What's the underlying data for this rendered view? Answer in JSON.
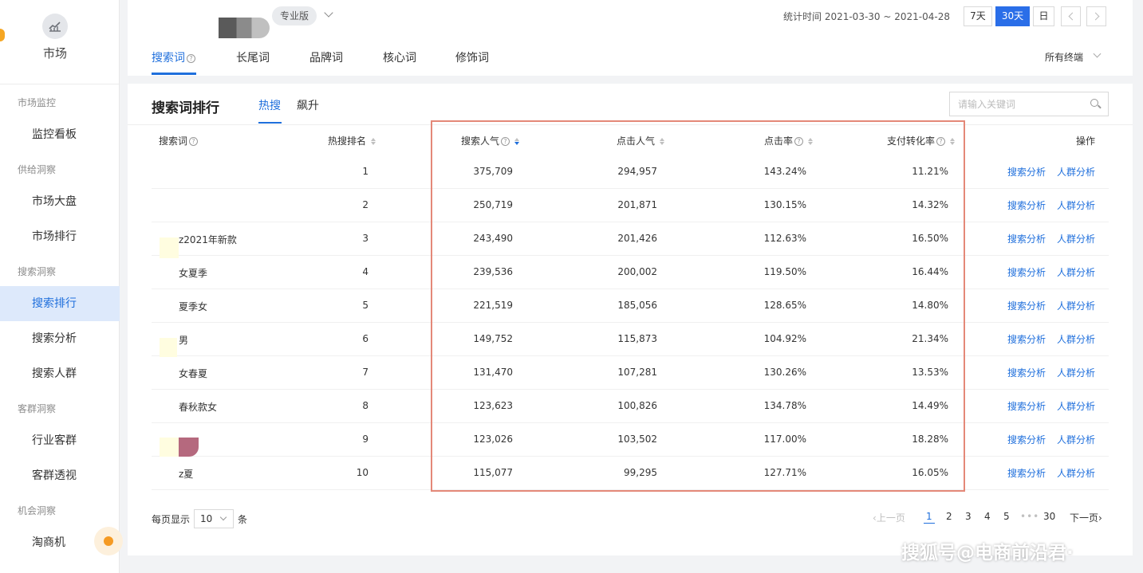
{
  "sidebar": {
    "title": "市场",
    "groups": [
      {
        "label": "市场监控",
        "items": [
          "监控看板"
        ]
      },
      {
        "label": "供给洞察",
        "items": [
          "市场大盘",
          "市场排行"
        ]
      },
      {
        "label": "搜索洞察",
        "items": [
          "搜索排行",
          "搜索分析",
          "搜索人群"
        ]
      },
      {
        "label": "客群洞察",
        "items": [
          "行业客群",
          "客群透视"
        ]
      },
      {
        "label": "机会洞察",
        "items": [
          "淘商机"
        ]
      }
    ],
    "active_item": "搜索排行"
  },
  "header": {
    "edition": "专业版",
    "stat_time": "统计时间 2021-03-30 ~ 2021-04-28",
    "periods": [
      "7天",
      "30天",
      "日"
    ],
    "active_period": "30天",
    "tabs": [
      "搜索词",
      "长尾词",
      "品牌词",
      "核心词",
      "修饰词"
    ],
    "active_tab": "搜索词",
    "terminal": "所有终端"
  },
  "ranking": {
    "title": "搜索词排行",
    "subtabs": [
      "热搜",
      "飙升"
    ],
    "active_subtab": "热搜",
    "search_placeholder": "请输入关键词",
    "columns": [
      "搜索词",
      "热搜排名",
      "搜索人气",
      "点击人气",
      "点击率",
      "支付转化率",
      "操作"
    ],
    "sorted_column": "搜索人气",
    "sort_order": "desc",
    "rows": [
      {
        "term": "",
        "rank": "1",
        "search": "375,709",
        "click": "294,957",
        "ctr": "143.24%",
        "cvr": "11.21%"
      },
      {
        "term": "",
        "rank": "2",
        "search": "250,719",
        "click": "201,871",
        "ctr": "130.15%",
        "cvr": "14.32%"
      },
      {
        "term": "z2021年新款",
        "rank": "3",
        "search": "243,490",
        "click": "201,426",
        "ctr": "112.63%",
        "cvr": "16.50%"
      },
      {
        "term": "女夏季",
        "rank": "4",
        "search": "239,536",
        "click": "200,002",
        "ctr": "119.50%",
        "cvr": "16.44%"
      },
      {
        "term": "夏季女",
        "rank": "5",
        "search": "221,519",
        "click": "185,056",
        "ctr": "128.65%",
        "cvr": "14.80%"
      },
      {
        "term": "男",
        "rank": "6",
        "search": "149,752",
        "click": "115,873",
        "ctr": "104.92%",
        "cvr": "21.34%"
      },
      {
        "term": "女春夏",
        "rank": "7",
        "search": "131,470",
        "click": "107,281",
        "ctr": "130.26%",
        "cvr": "13.53%"
      },
      {
        "term": "春秋款女",
        "rank": "8",
        "search": "123,623",
        "click": "100,826",
        "ctr": "134.78%",
        "cvr": "14.49%"
      },
      {
        "term": "",
        "rank": "9",
        "search": "123,026",
        "click": "103,502",
        "ctr": "117.00%",
        "cvr": "18.28%"
      },
      {
        "term": "z夏",
        "rank": "10",
        "search": "115,077",
        "click": "99,295",
        "ctr": "127.71%",
        "cvr": "16.05%"
      }
    ],
    "actions": [
      "搜索分析",
      "人群分析"
    ]
  },
  "pagination": {
    "per_page_label": "每页显示",
    "per_page_value": "10",
    "per_page_unit": "条",
    "prev": "上一页",
    "pages": [
      "1",
      "2",
      "3",
      "4",
      "5"
    ],
    "ellipsis": "•••",
    "last": "30",
    "next": "下一页",
    "current": "1"
  },
  "watermark": "搜狐号@电商前沿君·",
  "colors": {
    "accent": "#1f6fdc",
    "active_bg": "#dde9fb",
    "highlight_border": "#e48878"
  }
}
